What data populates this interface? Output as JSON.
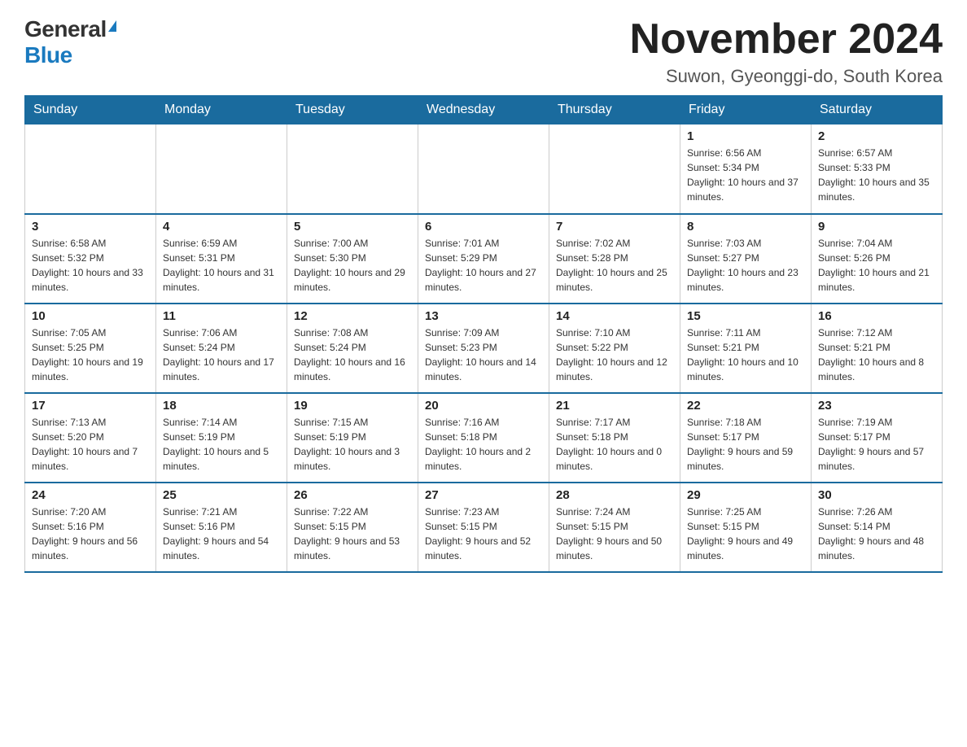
{
  "logo": {
    "general": "General",
    "blue": "Blue"
  },
  "title": "November 2024",
  "location": "Suwon, Gyeonggi-do, South Korea",
  "weekdays": [
    "Sunday",
    "Monday",
    "Tuesday",
    "Wednesday",
    "Thursday",
    "Friday",
    "Saturday"
  ],
  "weeks": [
    [
      {
        "day": "",
        "info": ""
      },
      {
        "day": "",
        "info": ""
      },
      {
        "day": "",
        "info": ""
      },
      {
        "day": "",
        "info": ""
      },
      {
        "day": "",
        "info": ""
      },
      {
        "day": "1",
        "info": "Sunrise: 6:56 AM\nSunset: 5:34 PM\nDaylight: 10 hours and 37 minutes."
      },
      {
        "day": "2",
        "info": "Sunrise: 6:57 AM\nSunset: 5:33 PM\nDaylight: 10 hours and 35 minutes."
      }
    ],
    [
      {
        "day": "3",
        "info": "Sunrise: 6:58 AM\nSunset: 5:32 PM\nDaylight: 10 hours and 33 minutes."
      },
      {
        "day": "4",
        "info": "Sunrise: 6:59 AM\nSunset: 5:31 PM\nDaylight: 10 hours and 31 minutes."
      },
      {
        "day": "5",
        "info": "Sunrise: 7:00 AM\nSunset: 5:30 PM\nDaylight: 10 hours and 29 minutes."
      },
      {
        "day": "6",
        "info": "Sunrise: 7:01 AM\nSunset: 5:29 PM\nDaylight: 10 hours and 27 minutes."
      },
      {
        "day": "7",
        "info": "Sunrise: 7:02 AM\nSunset: 5:28 PM\nDaylight: 10 hours and 25 minutes."
      },
      {
        "day": "8",
        "info": "Sunrise: 7:03 AM\nSunset: 5:27 PM\nDaylight: 10 hours and 23 minutes."
      },
      {
        "day": "9",
        "info": "Sunrise: 7:04 AM\nSunset: 5:26 PM\nDaylight: 10 hours and 21 minutes."
      }
    ],
    [
      {
        "day": "10",
        "info": "Sunrise: 7:05 AM\nSunset: 5:25 PM\nDaylight: 10 hours and 19 minutes."
      },
      {
        "day": "11",
        "info": "Sunrise: 7:06 AM\nSunset: 5:24 PM\nDaylight: 10 hours and 17 minutes."
      },
      {
        "day": "12",
        "info": "Sunrise: 7:08 AM\nSunset: 5:24 PM\nDaylight: 10 hours and 16 minutes."
      },
      {
        "day": "13",
        "info": "Sunrise: 7:09 AM\nSunset: 5:23 PM\nDaylight: 10 hours and 14 minutes."
      },
      {
        "day": "14",
        "info": "Sunrise: 7:10 AM\nSunset: 5:22 PM\nDaylight: 10 hours and 12 minutes."
      },
      {
        "day": "15",
        "info": "Sunrise: 7:11 AM\nSunset: 5:21 PM\nDaylight: 10 hours and 10 minutes."
      },
      {
        "day": "16",
        "info": "Sunrise: 7:12 AM\nSunset: 5:21 PM\nDaylight: 10 hours and 8 minutes."
      }
    ],
    [
      {
        "day": "17",
        "info": "Sunrise: 7:13 AM\nSunset: 5:20 PM\nDaylight: 10 hours and 7 minutes."
      },
      {
        "day": "18",
        "info": "Sunrise: 7:14 AM\nSunset: 5:19 PM\nDaylight: 10 hours and 5 minutes."
      },
      {
        "day": "19",
        "info": "Sunrise: 7:15 AM\nSunset: 5:19 PM\nDaylight: 10 hours and 3 minutes."
      },
      {
        "day": "20",
        "info": "Sunrise: 7:16 AM\nSunset: 5:18 PM\nDaylight: 10 hours and 2 minutes."
      },
      {
        "day": "21",
        "info": "Sunrise: 7:17 AM\nSunset: 5:18 PM\nDaylight: 10 hours and 0 minutes."
      },
      {
        "day": "22",
        "info": "Sunrise: 7:18 AM\nSunset: 5:17 PM\nDaylight: 9 hours and 59 minutes."
      },
      {
        "day": "23",
        "info": "Sunrise: 7:19 AM\nSunset: 5:17 PM\nDaylight: 9 hours and 57 minutes."
      }
    ],
    [
      {
        "day": "24",
        "info": "Sunrise: 7:20 AM\nSunset: 5:16 PM\nDaylight: 9 hours and 56 minutes."
      },
      {
        "day": "25",
        "info": "Sunrise: 7:21 AM\nSunset: 5:16 PM\nDaylight: 9 hours and 54 minutes."
      },
      {
        "day": "26",
        "info": "Sunrise: 7:22 AM\nSunset: 5:15 PM\nDaylight: 9 hours and 53 minutes."
      },
      {
        "day": "27",
        "info": "Sunrise: 7:23 AM\nSunset: 5:15 PM\nDaylight: 9 hours and 52 minutes."
      },
      {
        "day": "28",
        "info": "Sunrise: 7:24 AM\nSunset: 5:15 PM\nDaylight: 9 hours and 50 minutes."
      },
      {
        "day": "29",
        "info": "Sunrise: 7:25 AM\nSunset: 5:15 PM\nDaylight: 9 hours and 49 minutes."
      },
      {
        "day": "30",
        "info": "Sunrise: 7:26 AM\nSunset: 5:14 PM\nDaylight: 9 hours and 48 minutes."
      }
    ]
  ]
}
